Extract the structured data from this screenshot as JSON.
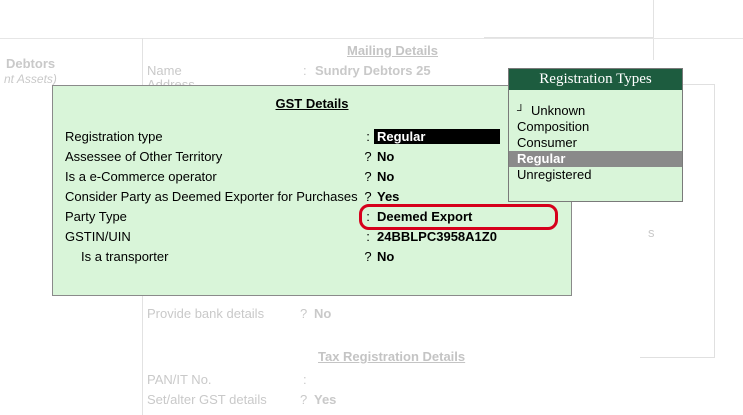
{
  "background": {
    "group_title": "Debtors",
    "group_subtitle": "nt Assets)",
    "mailing_section_title": "Mailing Details",
    "name_label": "Name",
    "name_value": "Sundry Debtors 25",
    "address_label": "Address",
    "side_letter": "s",
    "bank_label": "Provide bank details",
    "bank_value": "No",
    "tax_section_title": "Tax Registration Details",
    "pan_label": "PAN/IT No.",
    "gst_label": "Set/alter GST details",
    "gst_value": "Yes"
  },
  "gst_dialog": {
    "title": "GST Details",
    "rows": [
      {
        "label": "Registration type",
        "sep": ":",
        "value": "Regular"
      },
      {
        "label": "Assessee of Other Territory",
        "sep": "?",
        "value": "No"
      },
      {
        "label": "Is a e-Commerce operator",
        "sep": "?",
        "value": "No"
      },
      {
        "label": "Consider Party as Deemed Exporter for Purchases",
        "sep": "?",
        "value": "Yes"
      },
      {
        "label": "Party Type",
        "sep": ":",
        "value": "Deemed Export"
      },
      {
        "label": "GSTIN/UIN",
        "sep": ":",
        "value": "24BBLPC3958A1Z0"
      },
      {
        "label": "Is a transporter",
        "sep": "?",
        "value": "No"
      }
    ]
  },
  "registration_types": {
    "title": "Registration Types",
    "items": [
      "Unknown",
      "Composition",
      "Consumer",
      "Regular",
      "Unregistered"
    ],
    "selected": "Regular"
  },
  "colors": {
    "dialog_bg": "#d9f5d9",
    "popup_header": "#1d5c3f",
    "highlight": "#d6001c",
    "selected_item": "#8a8a8a"
  }
}
